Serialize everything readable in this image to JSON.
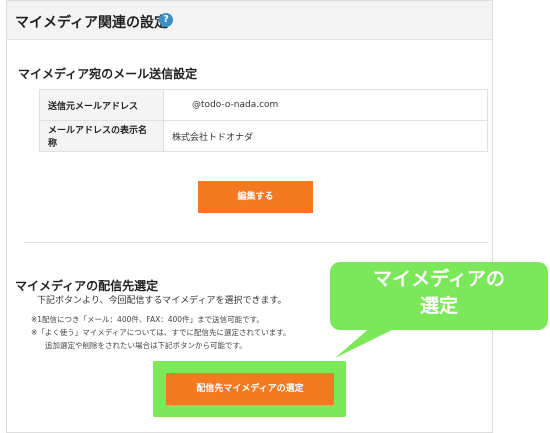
{
  "header": {
    "title": "マイメディア関連の設定",
    "help_icon": "?"
  },
  "mail_settings": {
    "title": "マイメディア宛のメール送信設定",
    "rows": [
      {
        "label": "送信元メールアドレス",
        "value": "@todo-o-nada.com"
      },
      {
        "label": "メールアドレスの表示名称",
        "value": "株式会社トドオナダ"
      }
    ],
    "edit_button": "編集する"
  },
  "delivery": {
    "title": "マイメディアの配信先選定",
    "description": "下記ボタンより、今回配信するマイメディアを選択できます。",
    "notes": [
      "※1配信につき「メール：400件、FAX：400件」まで送信可能です。",
      "※「よく使う」マイメディアについては、すでに配信先に選定されています。",
      "追加選定や削除をされたい場合は下記ボタンから可能です。"
    ],
    "select_button": "配信先マイメディアの選定"
  },
  "callout": {
    "line1": "マイメディアの",
    "line2": "選定",
    "color": "#7be85a"
  },
  "colors": {
    "accent": "#f37a20",
    "help": "#3b8fc4",
    "highlight": "#7be85a"
  }
}
